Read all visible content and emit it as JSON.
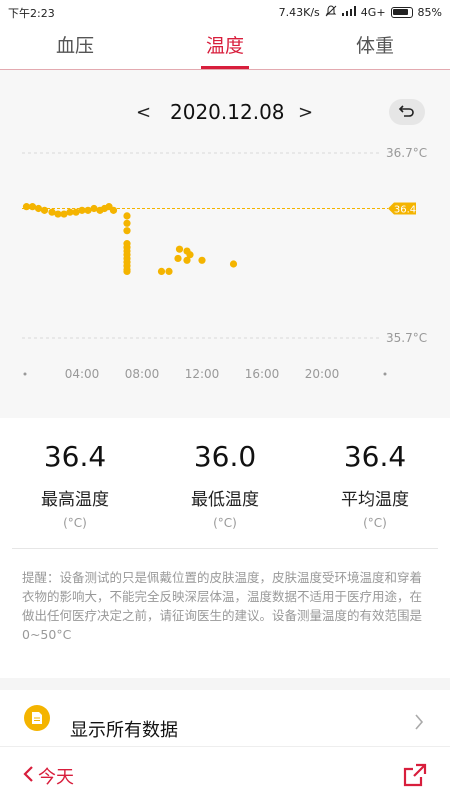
{
  "status_bar": {
    "time": "下午2:23",
    "network_speed": "7.43K/s",
    "network_type": "4G+",
    "battery": "85%"
  },
  "tabs": [
    {
      "label": "血压",
      "active": false
    },
    {
      "label": "温度",
      "active": true
    },
    {
      "label": "体重",
      "active": false
    }
  ],
  "date_nav": {
    "prev": "<",
    "date": "2020.12.08",
    "next": ">"
  },
  "chart_data": {
    "type": "scatter",
    "title": "",
    "xlabel": "",
    "ylabel": "",
    "x_ticks": [
      "04:00",
      "08:00",
      "12:00",
      "16:00",
      "20:00"
    ],
    "y_ticks": [
      "36.7°C",
      "35.7°C"
    ],
    "ylim": [
      35.7,
      36.7
    ],
    "xlim": [
      0,
      24
    ],
    "reference_line": {
      "value": 36.4,
      "label": "36.4"
    },
    "series": [
      {
        "points": [
          {
            "x": 0.3,
            "y": 36.41
          },
          {
            "x": 0.7,
            "y": 36.41
          },
          {
            "x": 1.1,
            "y": 36.4
          },
          {
            "x": 1.5,
            "y": 36.39
          },
          {
            "x": 2.0,
            "y": 36.38
          },
          {
            "x": 2.4,
            "y": 36.37
          },
          {
            "x": 2.8,
            "y": 36.37
          },
          {
            "x": 3.2,
            "y": 36.38
          },
          {
            "x": 3.6,
            "y": 36.38
          },
          {
            "x": 4.0,
            "y": 36.39
          },
          {
            "x": 4.4,
            "y": 36.39
          },
          {
            "x": 4.8,
            "y": 36.4
          },
          {
            "x": 5.2,
            "y": 36.39
          },
          {
            "x": 5.5,
            "y": 36.4
          },
          {
            "x": 5.8,
            "y": 36.41
          },
          {
            "x": 6.1,
            "y": 36.39
          },
          {
            "x": 7.0,
            "y": 36.36
          },
          {
            "x": 7.0,
            "y": 36.32
          },
          {
            "x": 7.0,
            "y": 36.28
          },
          {
            "x": 7.0,
            "y": 36.21
          },
          {
            "x": 7.0,
            "y": 36.19
          },
          {
            "x": 7.0,
            "y": 36.17
          },
          {
            "x": 7.0,
            "y": 36.15
          },
          {
            "x": 7.0,
            "y": 36.13
          },
          {
            "x": 7.0,
            "y": 36.11
          },
          {
            "x": 7.0,
            "y": 36.09
          },
          {
            "x": 7.0,
            "y": 36.07
          },
          {
            "x": 7.0,
            "y": 36.06
          },
          {
            "x": 9.3,
            "y": 36.06
          },
          {
            "x": 9.8,
            "y": 36.06
          },
          {
            "x": 10.5,
            "y": 36.18
          },
          {
            "x": 10.4,
            "y": 36.13
          },
          {
            "x": 11.0,
            "y": 36.17
          },
          {
            "x": 11.0,
            "y": 36.12
          },
          {
            "x": 11.2,
            "y": 36.15
          },
          {
            "x": 12.0,
            "y": 36.12
          },
          {
            "x": 14.1,
            "y": 36.1
          }
        ]
      }
    ]
  },
  "stats": [
    {
      "value": "36.4",
      "label": "最高温度",
      "unit": "(°C)"
    },
    {
      "value": "36.0",
      "label": "最低温度",
      "unit": "(°C)"
    },
    {
      "value": "36.4",
      "label": "平均温度",
      "unit": "(°C)"
    }
  ],
  "tip": "提醒：设备测试的只是佩戴位置的皮肤温度，皮肤温度受环境温度和穿着衣物的影响大，不能完全反映深层体温，温度数据不适用于医疗用途，在做出任何医疗决定之前，请征询医生的建议。设备测量温度的有效范围是 0~50°C",
  "all_data": {
    "label": "显示所有数据",
    "icon": "document-icon"
  },
  "bottom_bar": {
    "today_label": "今天",
    "share_icon": "share-icon"
  },
  "colors": {
    "accent": "#d81e3c",
    "point": "#f4b400",
    "reference": "#f4b400"
  }
}
